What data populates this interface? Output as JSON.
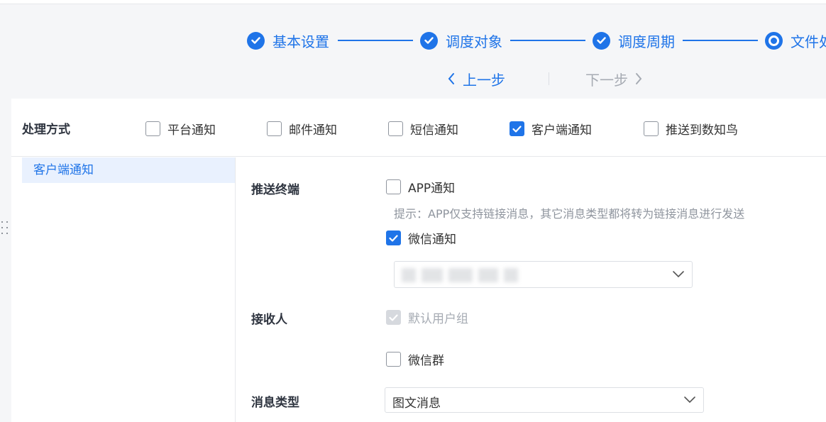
{
  "stepper": {
    "steps": [
      {
        "label": "基本设置",
        "state": "done"
      },
      {
        "label": "调度对象",
        "state": "done"
      },
      {
        "label": "调度周期",
        "state": "done"
      },
      {
        "label": "文件处",
        "state": "current"
      }
    ],
    "prev_label": "上一步",
    "next_label": "下一步",
    "accent": "#1f74e8"
  },
  "method": {
    "label": "处理方式",
    "options": [
      {
        "label": "平台通知",
        "checked": false
      },
      {
        "label": "邮件通知",
        "checked": false
      },
      {
        "label": "短信通知",
        "checked": false
      },
      {
        "label": "客户端通知",
        "checked": true
      },
      {
        "label": "推送到数知鸟",
        "checked": false
      }
    ]
  },
  "sidebar": {
    "items": [
      {
        "label": "客户端通知",
        "active": true
      }
    ]
  },
  "form": {
    "terminal_label": "推送终端",
    "app_notify": {
      "label": "APP通知",
      "checked": false
    },
    "hint": "提示：APP仅支持链接消息，其它消息类型都将转为链接消息进行发送",
    "wechat_notify": {
      "label": "微信通知",
      "checked": true
    },
    "wechat_account_select": {
      "value": ""
    },
    "receiver_label": "接收人",
    "default_group": {
      "label": "默认用户组",
      "checked": true,
      "disabled": true
    },
    "wechat_group": {
      "label": "微信群",
      "checked": false
    },
    "msg_type_label": "消息类型",
    "msg_type_select": {
      "value": "图文消息"
    }
  }
}
